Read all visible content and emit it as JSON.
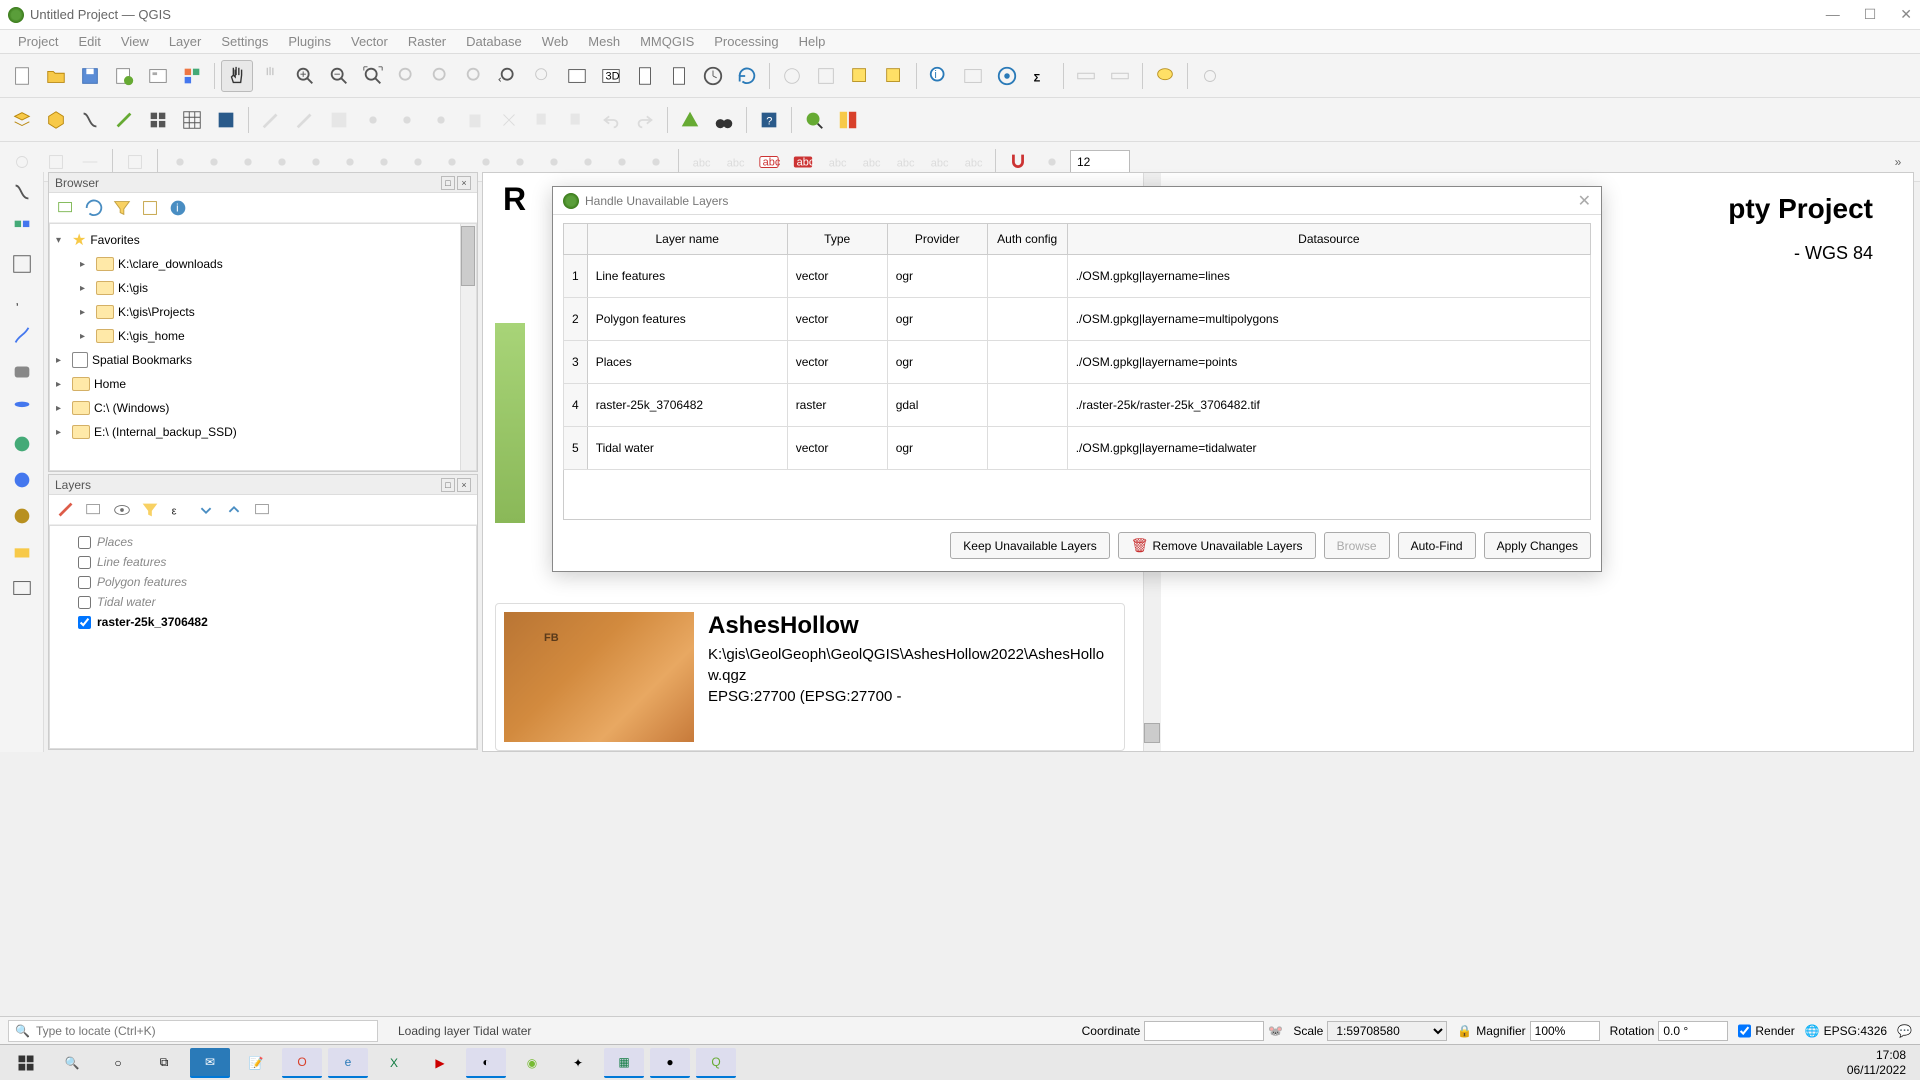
{
  "window": {
    "title": "Untitled Project — QGIS"
  },
  "menu": [
    "Project",
    "Edit",
    "View",
    "Layer",
    "Settings",
    "Plugins",
    "Vector",
    "Raster",
    "Database",
    "Web",
    "Mesh",
    "MMQGIS",
    "Processing",
    "Help"
  ],
  "browser": {
    "title": "Browser",
    "items": [
      {
        "label": "Favorites",
        "type": "star",
        "expand": "▾"
      },
      {
        "label": "K:\\clare_downloads",
        "type": "folder",
        "expand": "▸",
        "indent": 1
      },
      {
        "label": "K:\\gis",
        "type": "folder",
        "expand": "▸",
        "indent": 1
      },
      {
        "label": "K:\\gis\\Projects",
        "type": "folder",
        "expand": "▸",
        "indent": 1
      },
      {
        "label": "K:\\gis_home",
        "type": "folder",
        "expand": "▸",
        "indent": 1
      },
      {
        "label": "Spatial Bookmarks",
        "type": "bookmark",
        "expand": "▸"
      },
      {
        "label": "Home",
        "type": "folder",
        "expand": "▸"
      },
      {
        "label": "C:\\ (Windows)",
        "type": "folder",
        "expand": "▸"
      },
      {
        "label": "E:\\ (Internal_backup_SSD)",
        "type": "folder",
        "expand": "▸"
      }
    ]
  },
  "layers": {
    "title": "Layers",
    "items": [
      {
        "name": "Places",
        "checked": false
      },
      {
        "name": "Line features",
        "checked": false
      },
      {
        "name": "Polygon features",
        "checked": false
      },
      {
        "name": "Tidal water",
        "checked": false
      },
      {
        "name": "raster-25k_3706482",
        "checked": true
      }
    ]
  },
  "main": {
    "new_project": "pty Project",
    "crs": "- WGS 84",
    "recent_title_partial": "R",
    "card": {
      "title": "AshesHollow",
      "path": "K:\\gis\\GeolGeoph\\GeolQGIS\\AshesHollow2022\\AshesHollow.qgz",
      "crs": "EPSG:27700 (EPSG:27700 -"
    }
  },
  "dialog": {
    "title": "Handle Unavailable Layers",
    "columns": [
      "Layer name",
      "Type",
      "Provider",
      "Auth config",
      "Datasource"
    ],
    "rows": [
      {
        "n": "1",
        "name": "Line features",
        "type": "vector",
        "provider": "ogr",
        "auth": "",
        "ds": "./OSM.gpkg|layername=lines"
      },
      {
        "n": "2",
        "name": "Polygon features",
        "type": "vector",
        "provider": "ogr",
        "auth": "",
        "ds": "./OSM.gpkg|layername=multipolygons"
      },
      {
        "n": "3",
        "name": "Places",
        "type": "vector",
        "provider": "ogr",
        "auth": "",
        "ds": "./OSM.gpkg|layername=points"
      },
      {
        "n": "4",
        "name": "raster-25k_3706482",
        "type": "raster",
        "provider": "gdal",
        "auth": "",
        "ds": "./raster-25k/raster-25k_3706482.tif"
      },
      {
        "n": "5",
        "name": "Tidal water",
        "type": "vector",
        "provider": "ogr",
        "auth": "",
        "ds": "./OSM.gpkg|layername=tidalwater"
      }
    ],
    "buttons": {
      "keep": "Keep Unavailable Layers",
      "remove": "Remove Unavailable Layers",
      "browse": "Browse",
      "autofind": "Auto-Find",
      "apply": "Apply Changes"
    }
  },
  "status": {
    "locator_placeholder": "Type to locate (Ctrl+K)",
    "loading": "Loading layer Tidal water",
    "coordinate_label": "Coordinate",
    "coordinate_value": "",
    "scale_label": "Scale",
    "scale_value": "1:59708580",
    "magnifier_label": "Magnifier",
    "magnifier_value": "100%",
    "rotation_label": "Rotation",
    "rotation_value": "0.0 °",
    "render_label": "Render",
    "crs": "EPSG:4326"
  },
  "clock": {
    "time": "17:08",
    "date": "06/11/2022"
  },
  "toolbar3_spin": "12"
}
